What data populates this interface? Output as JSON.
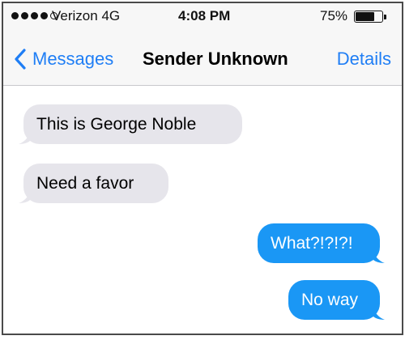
{
  "status_bar": {
    "signal_bars_filled": 4,
    "signal_bars_total": 5,
    "carrier": "Verizon",
    "network": "4G",
    "time": "4:08 PM",
    "battery_percent_label": "75%",
    "battery_level": 0.75
  },
  "nav": {
    "back_label": "Messages",
    "title": "Sender Unknown",
    "details_label": "Details"
  },
  "messages": [
    {
      "text": "This is George Noble",
      "direction": "received"
    },
    {
      "text": "Need a favor",
      "direction": "received"
    },
    {
      "text": "What?!?!?!",
      "direction": "sent"
    },
    {
      "text": "No way",
      "direction": "sent"
    }
  ],
  "colors": {
    "accent": "#1f7ef5",
    "sent_bubble": "#1a97f5",
    "received_bubble": "#e6e5eb"
  }
}
